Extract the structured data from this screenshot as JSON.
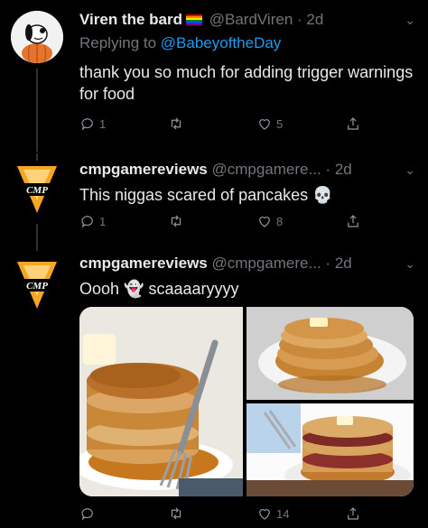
{
  "tweets": [
    {
      "display_name": "Viren the bard",
      "handle": "@BardViren",
      "separator": "·",
      "time": "2d",
      "replying_prefix": "Replying to",
      "replying_to": "@BabeyoftheDay",
      "text": "thank you so much for adding trigger warnings for food",
      "reply_count": "1",
      "retweet_count": "",
      "like_count": "5"
    },
    {
      "display_name": "cmpgamereviews",
      "handle": "@cmpgamere...",
      "separator": "·",
      "time": "2d",
      "text": "This niggas scared of pancakes",
      "text_emoji": "💀",
      "reply_count": "1",
      "retweet_count": "",
      "like_count": "8"
    },
    {
      "display_name": "cmpgamereviews",
      "handle": "@cmpgamere...",
      "separator": "·",
      "time": "2d",
      "text_prefix": "Oooh",
      "text_emoji": "👻",
      "text": "scaaaaryyyy",
      "reply_count": "",
      "retweet_count": "",
      "like_count": "14"
    }
  ],
  "avatar_logo_text": "CMP",
  "icons": {
    "reply": "reply-icon",
    "retweet": "retweet-icon",
    "like": "heart-icon",
    "share": "share-icon",
    "more": "chevron-down-icon"
  },
  "colors": {
    "background": "#000000",
    "text": "#e7e9ea",
    "muted": "#71767b",
    "link": "#1d9bf0",
    "avatar_triangle": "#f5a623"
  }
}
